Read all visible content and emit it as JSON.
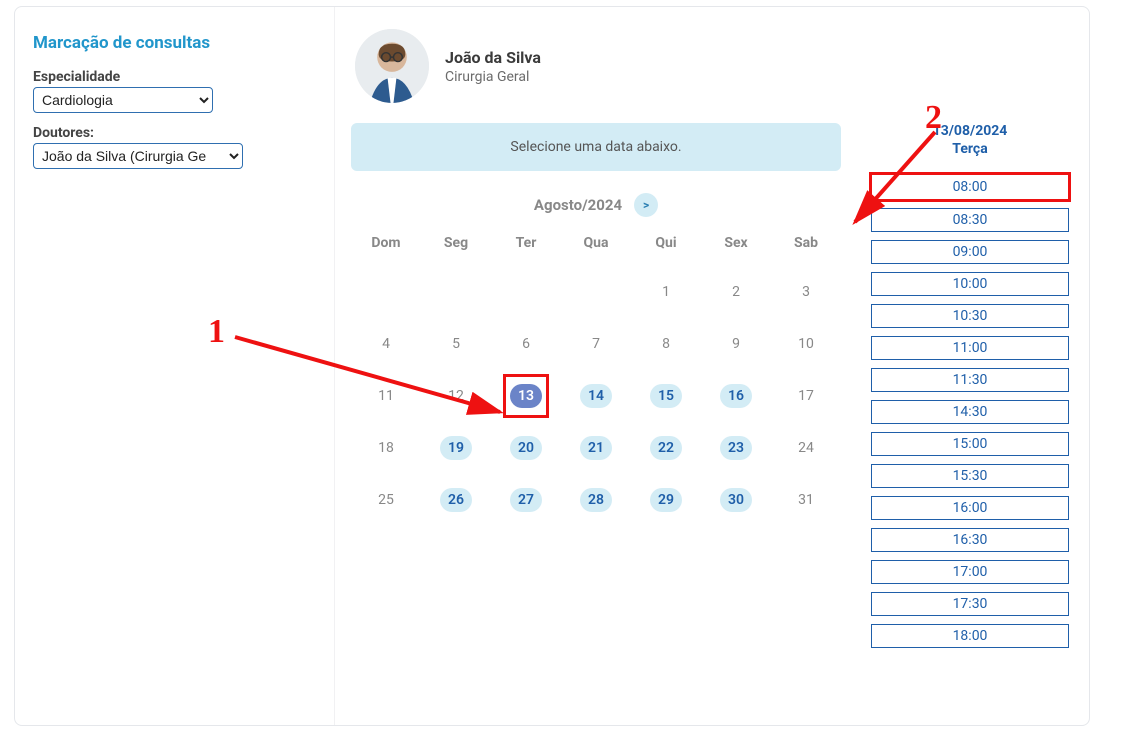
{
  "sidebar": {
    "title": "Marcação de consultas",
    "specialty_label": "Especialidade",
    "specialty_value": "Cardiologia",
    "doctors_label": "Doutores:",
    "doctor_value": "João da Silva (Cirurgia Ge"
  },
  "doctor": {
    "name": "João da Silva",
    "specialty": "Cirurgia Geral"
  },
  "banner": "Selecione uma data abaixo.",
  "calendar": {
    "month_label": "Agosto/2024",
    "next_label": ">",
    "weekdays": [
      "Dom",
      "Seg",
      "Ter",
      "Qua",
      "Qui",
      "Sex",
      "Sab"
    ],
    "rows": [
      [
        {
          "n": ""
        },
        {
          "n": ""
        },
        {
          "n": ""
        },
        {
          "n": ""
        },
        {
          "n": "1"
        },
        {
          "n": "2"
        },
        {
          "n": "3"
        }
      ],
      [
        {
          "n": "4"
        },
        {
          "n": "5"
        },
        {
          "n": "6"
        },
        {
          "n": "7"
        },
        {
          "n": "8"
        },
        {
          "n": "9"
        },
        {
          "n": "10"
        }
      ],
      [
        {
          "n": "11"
        },
        {
          "n": "12"
        },
        {
          "n": "13",
          "avail": true,
          "selected": true,
          "boxed": true
        },
        {
          "n": "14",
          "avail": true
        },
        {
          "n": "15",
          "avail": true
        },
        {
          "n": "16",
          "avail": true
        },
        {
          "n": "17"
        }
      ],
      [
        {
          "n": "18"
        },
        {
          "n": "19",
          "avail": true
        },
        {
          "n": "20",
          "avail": true
        },
        {
          "n": "21",
          "avail": true
        },
        {
          "n": "22",
          "avail": true
        },
        {
          "n": "23",
          "avail": true
        },
        {
          "n": "24"
        }
      ],
      [
        {
          "n": "25"
        },
        {
          "n": "26",
          "avail": true
        },
        {
          "n": "27",
          "avail": true
        },
        {
          "n": "28",
          "avail": true
        },
        {
          "n": "29",
          "avail": true
        },
        {
          "n": "30",
          "avail": true
        },
        {
          "n": "31"
        }
      ]
    ]
  },
  "slots": {
    "date_line": "13/08/2024",
    "weekday_line": "Terça",
    "times": [
      {
        "t": "08:00",
        "hi": true
      },
      {
        "t": "08:30"
      },
      {
        "t": "09:00"
      },
      {
        "t": "10:00"
      },
      {
        "t": "10:30"
      },
      {
        "t": "11:00"
      },
      {
        "t": "11:30"
      },
      {
        "t": "14:30"
      },
      {
        "t": "15:00"
      },
      {
        "t": "15:30"
      },
      {
        "t": "16:00"
      },
      {
        "t": "16:30"
      },
      {
        "t": "17:00"
      },
      {
        "t": "17:30"
      },
      {
        "t": "18:00"
      }
    ]
  },
  "annotations": {
    "label1": "1",
    "label2": "2"
  },
  "colors": {
    "accent": "#1f5fa9",
    "pill_bg": "#d3ecf5",
    "highlight": "#e11"
  }
}
